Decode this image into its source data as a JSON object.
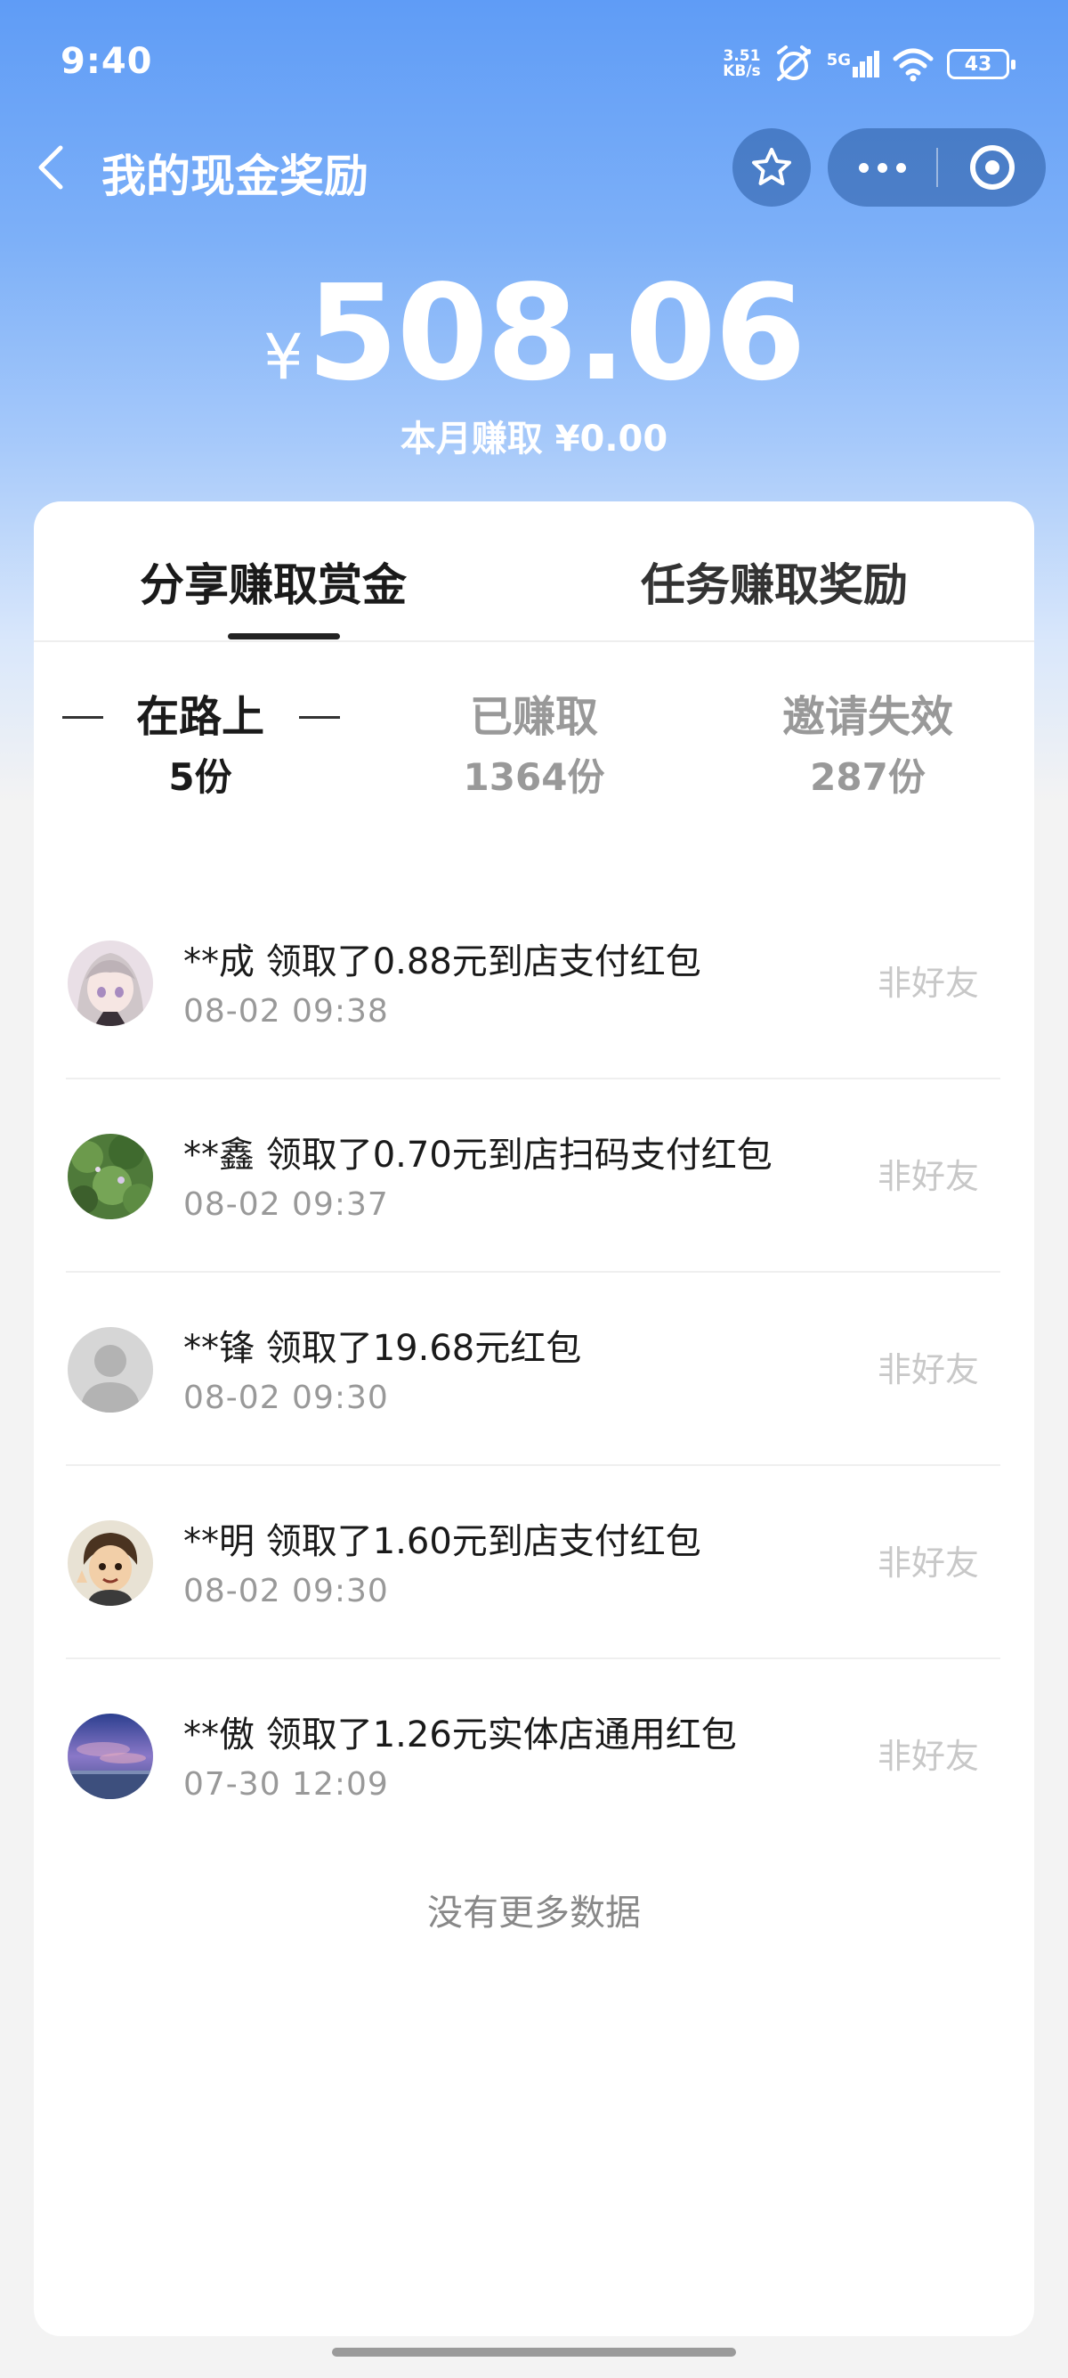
{
  "status_bar": {
    "time": "9:40",
    "net_speed_value": "3.51",
    "net_speed_unit": "KB/s",
    "network_label": "5G",
    "battery": "43"
  },
  "nav": {
    "title": "我的现金奖励",
    "icons": [
      "back-arrow-icon",
      "star-icon",
      "more-icon",
      "close-target-icon"
    ]
  },
  "balance": {
    "currency": "¥",
    "amount": "508.06",
    "monthly_label": "本月赚取 ¥0.00"
  },
  "main_tabs": [
    {
      "label": "分享赚取赏金",
      "active": true
    },
    {
      "label": "任务赚取奖励",
      "active": false
    }
  ],
  "sub_tabs": [
    {
      "label": "在路上",
      "count": "5份",
      "active": true
    },
    {
      "label": "已赚取",
      "count": "1364份",
      "active": false
    },
    {
      "label": "邀请失效",
      "count": "287份",
      "active": false
    }
  ],
  "records": [
    {
      "title": "**成 领取了0.88元到店支付红包",
      "time": "08-02 09:38",
      "tag": "非好友",
      "avatar": "anime-girl-avatar"
    },
    {
      "title": "**鑫 领取了0.70元到店扫码支付红包",
      "time": "08-02 09:37",
      "tag": "非好友",
      "avatar": "green-leaves-avatar"
    },
    {
      "title": "**锋 领取了19.68元红包",
      "time": "08-02 09:30",
      "tag": "非好友",
      "avatar": "default-user-avatar"
    },
    {
      "title": "**明 领取了1.60元到店支付红包",
      "time": "08-02 09:30",
      "tag": "非好友",
      "avatar": "cartoon-boy-avatar"
    },
    {
      "title": "**傲 领取了1.26元实体店通用红包",
      "time": "07-30 12:09",
      "tag": "非好友",
      "avatar": "sky-landscape-avatar"
    }
  ],
  "footer": {
    "no_more": "没有更多数据"
  },
  "colors": {
    "header_gradient_top": "#5f9cf6",
    "header_gradient_bottom": "#f3f3f3",
    "card_bg": "#ffffff",
    "primary_text": "#1a1a1a",
    "secondary_text": "#999999",
    "tag_text": "#c8c8c8"
  }
}
